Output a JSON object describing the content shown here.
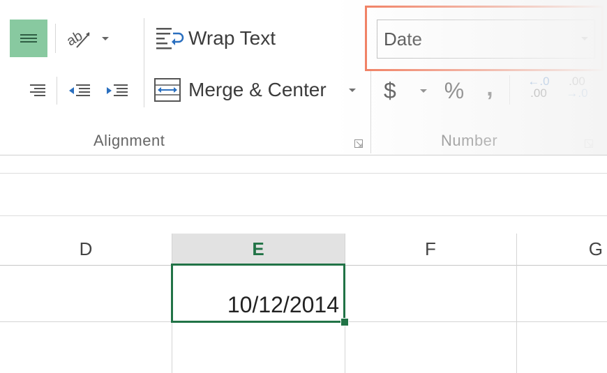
{
  "ribbon": {
    "alignment": {
      "wrap_text_label": "Wrap Text",
      "merge_center_label": "Merge & Center",
      "group_label": "Alignment"
    },
    "number": {
      "format_value": "Date",
      "currency_symbol": "$",
      "percent_symbol": "%",
      "comma_symbol": ",",
      "increase_decimal_top": "←.0",
      "increase_decimal_bottom": ".00",
      "decrease_decimal_top": ".00",
      "decrease_decimal_bottom": "→.0",
      "group_label": "Number"
    },
    "highlight_color": "#f07353",
    "selected_fill": "#88c9a0"
  },
  "sheet": {
    "columns": [
      "D",
      "E",
      "F",
      "G"
    ],
    "active_column": "E",
    "active_cell_value": "10/12/2014",
    "selection_color": "#217346"
  }
}
